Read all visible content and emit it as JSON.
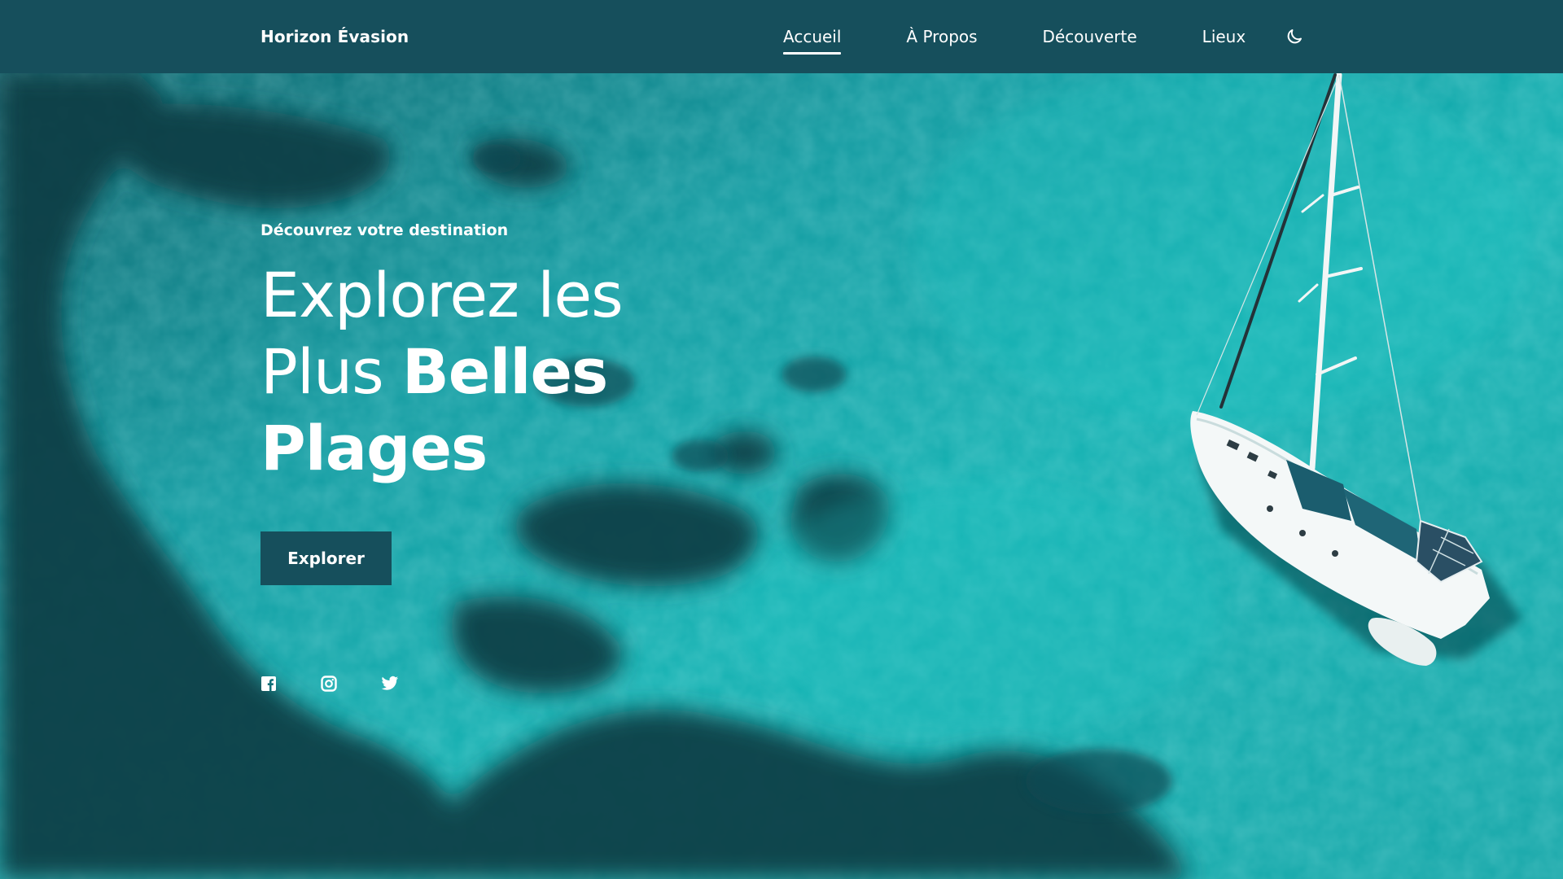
{
  "header": {
    "brand": "Horizon Évasion",
    "nav": [
      {
        "label": "Accueil",
        "active": true
      },
      {
        "label": "À Propos",
        "active": false
      },
      {
        "label": "Découverte",
        "active": false
      },
      {
        "label": "Lieux",
        "active": false
      }
    ],
    "theme_toggle_icon": "moon-icon",
    "background_color": "#164f5c"
  },
  "hero": {
    "subtitle": "Découvrez votre destination",
    "title_line1": "Explorez les",
    "title_line2_light": "Plus ",
    "title_line2_bold": "Belles",
    "title_line3": "Plages",
    "button_label": "Explorer"
  },
  "socials": [
    {
      "icon": "facebook-icon"
    },
    {
      "icon": "instagram-icon"
    },
    {
      "icon": "twitter-icon"
    }
  ],
  "colors": {
    "accent": "#164f5c",
    "text": "#ffffff",
    "sea": "#14adae"
  }
}
